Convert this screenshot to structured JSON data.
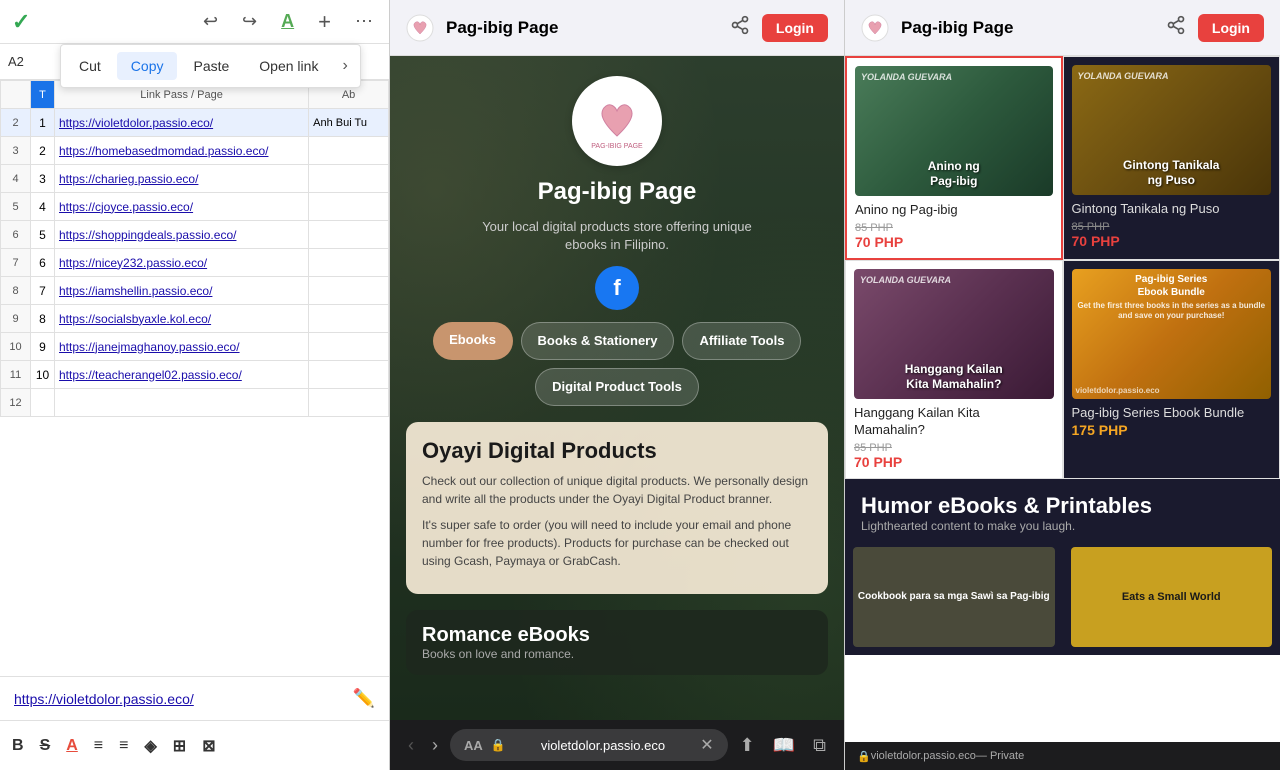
{
  "spreadsheet": {
    "check_icon": "✓",
    "undo_icon": "↩",
    "redo_icon": "↪",
    "text_format_icon": "A",
    "plus_icon": "+",
    "more_icon": "⋯",
    "context_menu": {
      "cut_label": "Cut",
      "copy_label": "Copy",
      "paste_label": "Paste",
      "open_link_label": "Open link",
      "more_arrow": "›"
    },
    "cell_ref": "A2",
    "formula_value": "https://violetdolor.passio.eco/",
    "columns": {
      "t_header": "T",
      "link_pass_page_header": "Link Pass / Page",
      "ab_header": "Ab"
    },
    "rows": [
      {
        "row_num": "",
        "col_t": "T",
        "link": "Link Pass / Page",
        "ab": "Ab",
        "is_header": true
      },
      {
        "row_num": "1",
        "col_t": "1",
        "link": "https://violetdolor.passio.eco/",
        "ab": "Anh Bui Tu",
        "highlighted": true
      },
      {
        "row_num": "2",
        "col_t": "2",
        "link": "https://homebasedmomdad.passio.eco/",
        "ab": ""
      },
      {
        "row_num": "3",
        "col_t": "3",
        "link": "https://charieg.passio.eco/",
        "ab": ""
      },
      {
        "row_num": "4",
        "col_t": "4",
        "link": "https://cjoyce.passio.eco/",
        "ab": ""
      },
      {
        "row_num": "5",
        "col_t": "5",
        "link": "https://shoppingdeals.passio.eco/",
        "ab": ""
      },
      {
        "row_num": "6",
        "col_t": "6",
        "link": "https://nicey232.passio.eco/",
        "ab": ""
      },
      {
        "row_num": "7",
        "col_t": "7",
        "link": "https://iamshellin.passio.eco/",
        "ab": ""
      },
      {
        "row_num": "8",
        "col_t": "8",
        "link": "https://socialsbyaxle.kol.eco/",
        "ab": ""
      },
      {
        "row_num": "9",
        "col_t": "9",
        "link": "https://janejmaghanoy.passio.eco/",
        "ab": ""
      },
      {
        "row_num": "10",
        "col_t": "10",
        "link": "https://teacherangel02.passio.eco/",
        "ab": ""
      }
    ],
    "link_bar_url": "https://violetdolor.passio.eco/",
    "format_icons": [
      "B",
      "S",
      "A",
      "≡",
      "≡",
      "◈",
      "⊞",
      "⊠"
    ]
  },
  "middle_panel": {
    "browser_title": "Pag-ibig Page",
    "login_label": "Login",
    "page_title": "Pag-ibig Page",
    "page_subtitle": "Your local digital products store offering unique ebooks in Filipino.",
    "category_tabs": [
      {
        "label": "Ebooks",
        "active": true
      },
      {
        "label": "Books & Stationery",
        "active": false
      },
      {
        "label": "Affiliate Tools",
        "active": false
      },
      {
        "label": "Digital Product Tools",
        "active": false
      }
    ],
    "section1_title": "Oyayi Digital Products",
    "section1_text1": "Check out our collection of unique digital products. We personally design and write all the products under the Oyayi Digital Product branner.",
    "section1_text2": "It's super safe to order (you will need to include your email and phone number for free products). Products for purchase can be checked out using Gcash, Paymaya or GrabCash.",
    "section2_title": "Romance eBooks",
    "section2_subtitle": "Books on love and romance.",
    "url_bar": {
      "aa_label": "AA",
      "lock_icon": "🔒",
      "url": "violetdolor.passio.eco",
      "close_icon": "✕"
    },
    "nav": {
      "back": "‹",
      "forward": "›",
      "share": "⬆",
      "bookmark": "📖",
      "tabs": "⧉"
    }
  },
  "right_panel": {
    "browser_title": "Pag-ibig Page",
    "login_label": "Login",
    "products": [
      {
        "id": "anino",
        "name": "Anino ng Pag-ibig",
        "old_price": "85 PHP",
        "new_price": "70 PHP",
        "selected": true,
        "cover_label": "Anino ng Pag-ibig",
        "author": "Yolanda Guevara",
        "bg_class": "book-cover-1"
      },
      {
        "id": "gintong",
        "name": "Gintong Tanikala ng Puso",
        "old_price": "85 PHP",
        "new_price": "70 PHP",
        "selected": false,
        "dark": true,
        "cover_label": "Gintong Tanikala ng Puso",
        "author": "Yolanda Guevara",
        "bg_class": "book-cover-2"
      },
      {
        "id": "hanggang",
        "name": "Hanggang Kailan Kita Mamahalin?",
        "old_price": "85 PHP",
        "new_price": "70 PHP",
        "selected": false,
        "cover_label": "Hanggang Kailan Kita Mamahalin?",
        "author": "Yolanda Guevara",
        "bg_class": "book-cover-3"
      },
      {
        "id": "bundle",
        "name": "Pag-ibig Series Ebook Bundle",
        "old_price": "",
        "new_price": "175 PHP",
        "selected": false,
        "dark": true,
        "cover_label": "Pag-ibig Series Ebook Bundle",
        "cover_subtitle": "Get the first three books in the series as a bundle and save on your purchase!",
        "bg_class": "book-cover-4"
      }
    ],
    "humor_section_title": "Humor eBooks & Printables",
    "humor_section_subtitle": "Lighthearted content to make you laugh.",
    "bottom_books": [
      {
        "label": "Cookbook para sa mga Sawì sa Pag-ibig",
        "bg": "#3a3a2a"
      },
      {
        "label": "Eats a Small World",
        "bg": "#c8a020"
      }
    ],
    "private_bar_text": "violetdolor.passio.eco",
    "private_label": "— Private"
  }
}
